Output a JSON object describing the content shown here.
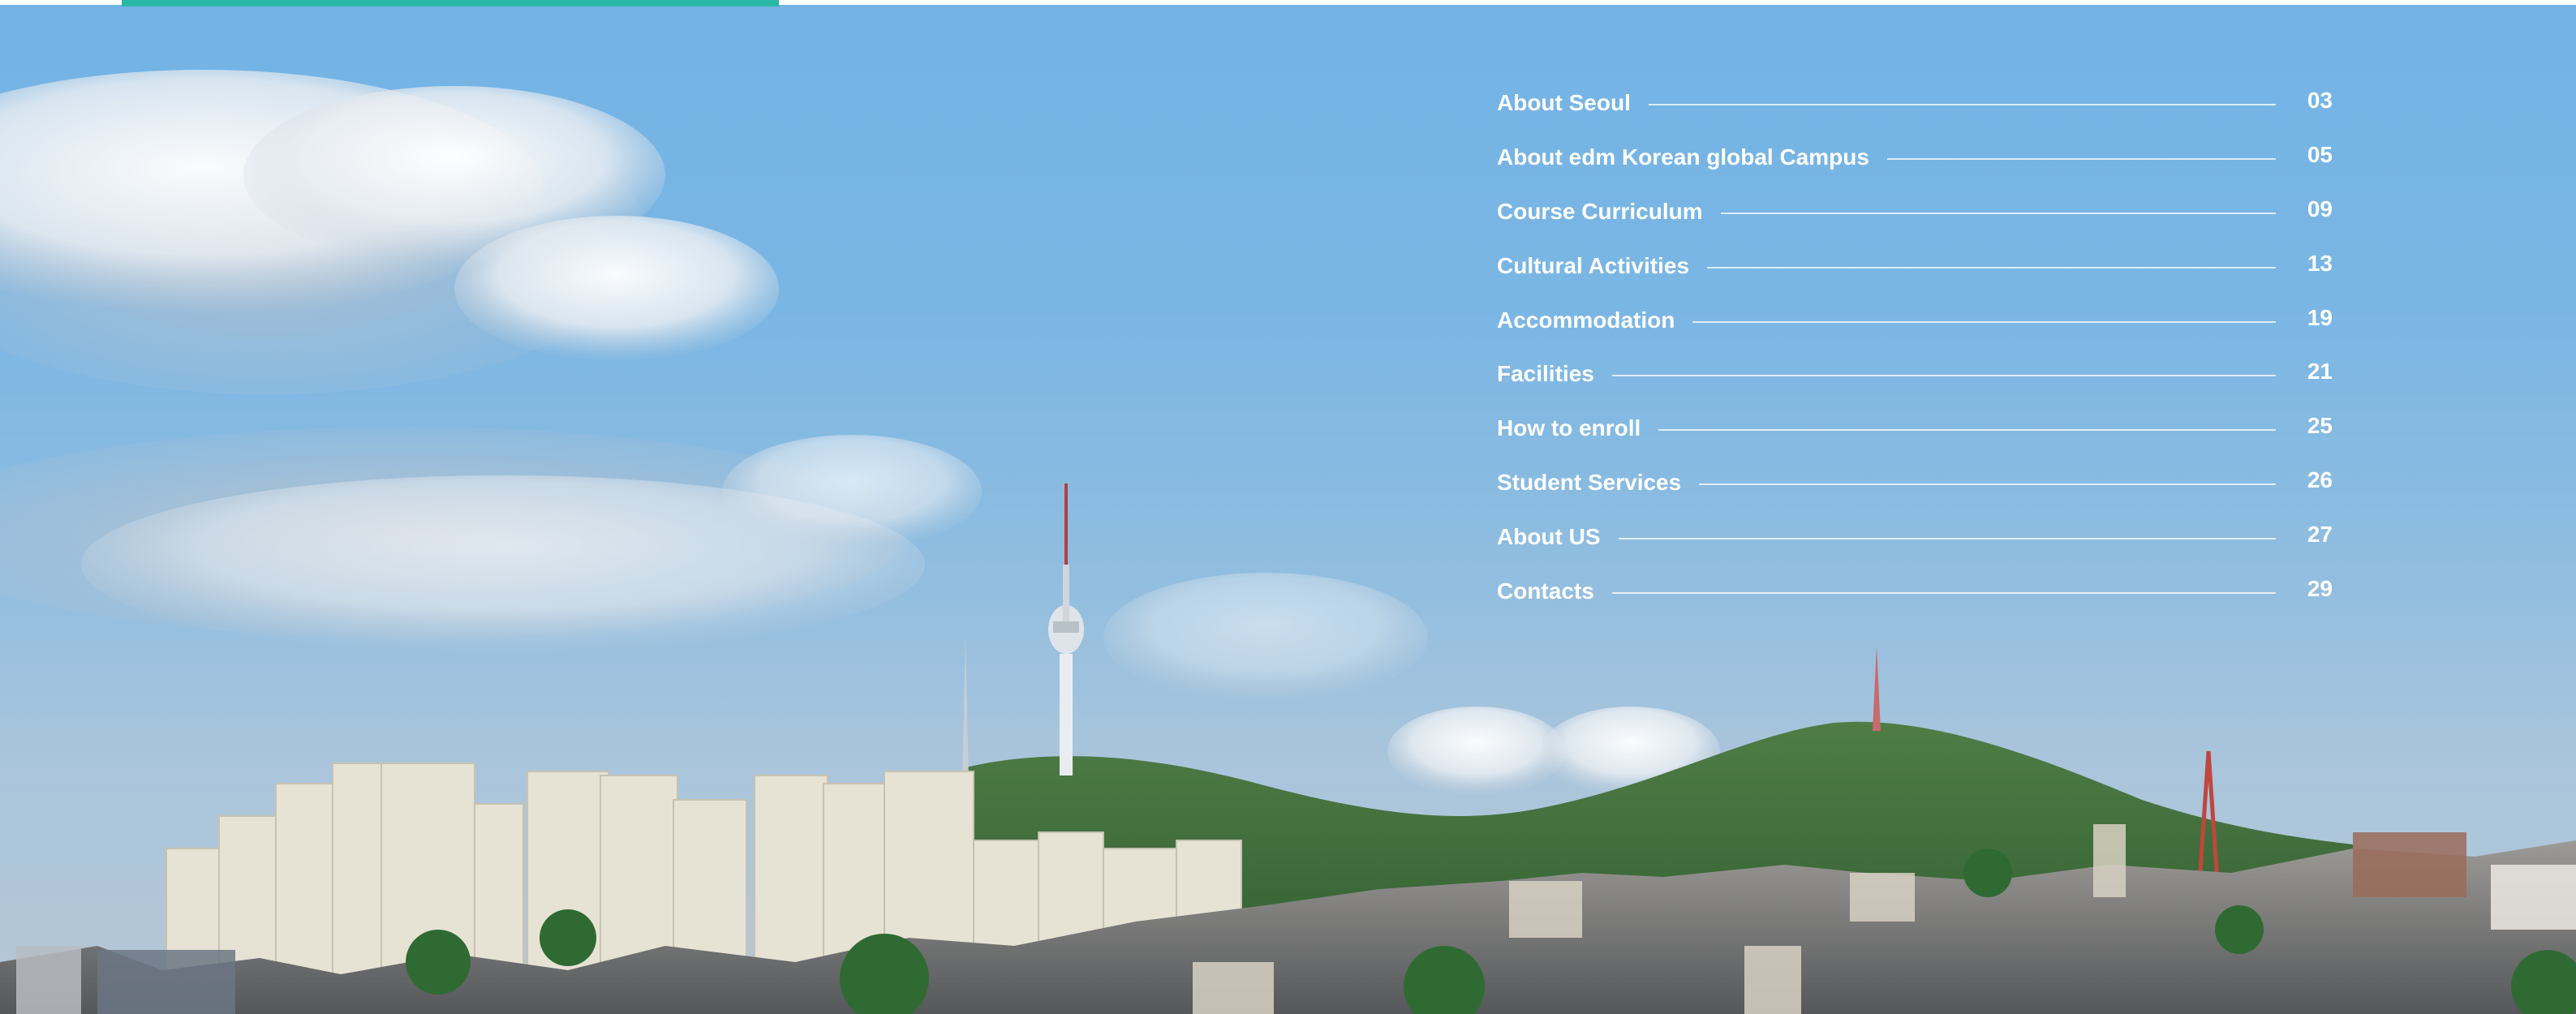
{
  "colors": {
    "accent": "#27b9a6",
    "sky": "#73b3e5",
    "text": "#ffffff"
  },
  "toc": {
    "items": [
      {
        "title": "About Seoul",
        "page": "03"
      },
      {
        "title": "About edm Korean global Campus",
        "page": "05"
      },
      {
        "title": "Course Curriculum",
        "page": "09"
      },
      {
        "title": "Cultural Activities",
        "page": "13"
      },
      {
        "title": "Accommodation",
        "page": "19"
      },
      {
        "title": "Facilities",
        "page": "21"
      },
      {
        "title": "How to enroll",
        "page": "25"
      },
      {
        "title": "Student Services",
        "page": "26"
      },
      {
        "title": "About US",
        "page": "27"
      },
      {
        "title": "Contacts",
        "page": "29"
      }
    ]
  }
}
